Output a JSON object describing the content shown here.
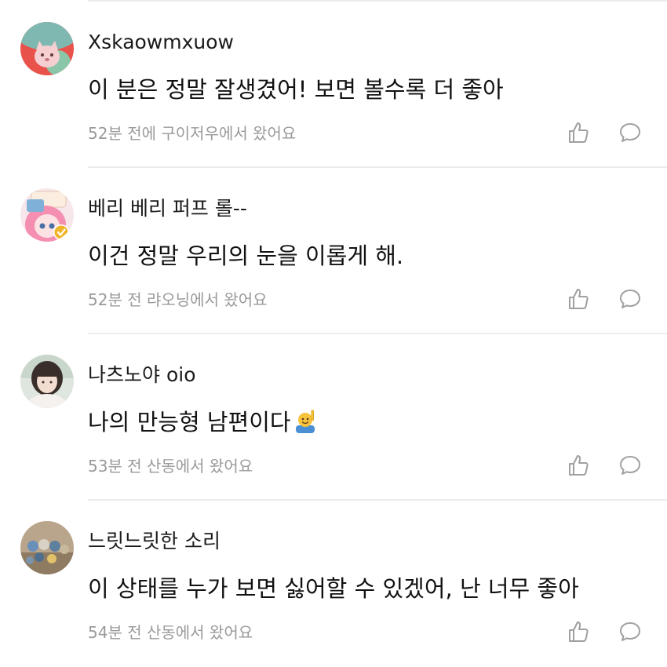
{
  "comments": [
    {
      "username": "Xskaowmxuow",
      "text": "이 분은 정말 잘생겼어! 보면 볼수록 더 좋아",
      "meta": "52분 전에 구이저우에서 왔어요",
      "avatar": "pink-cat-avatar"
    },
    {
      "username": "베리 베리 퍼프 롤--",
      "text": "이건 정말 우리의 눈을 이롭게 해.",
      "meta": "52분 전 랴오닝에서 왔어요",
      "avatar": "anime-girl-avatar"
    },
    {
      "username": "나츠노야 oio",
      "text": "나의 만능형 남편이다",
      "meta": "53분 전 산동에서 왔어요",
      "avatar": "girl-photo-avatar",
      "emoji": "person-raising-hand-emoji"
    },
    {
      "username": "느릿느릿한 소리",
      "text": "이 상태를 누가 보면 싫어할 수 있겠어, 난 너무 좋아",
      "meta": "54분 전 산동에서 왔어요",
      "avatar": "figurines-photo-avatar"
    }
  ],
  "icons": {
    "like": "thumbs-up-icon",
    "reply": "speech-bubble-icon"
  },
  "colors": {
    "meta_text": "#9a9a9a",
    "icon": "#a0a0a0",
    "divider": "#ececec",
    "verified_badge": "#f0b429"
  }
}
